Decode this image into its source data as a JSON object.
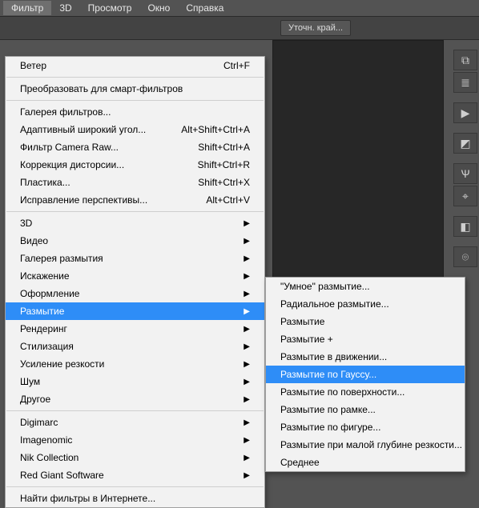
{
  "menubar": {
    "items": [
      {
        "label": "Фильтр",
        "active": true
      },
      {
        "label": "3D"
      },
      {
        "label": "Просмотр"
      },
      {
        "label": "Окно"
      },
      {
        "label": "Справка"
      }
    ]
  },
  "toolbar": {
    "refine_edge_label": "Уточн. край..."
  },
  "main_menu": {
    "groups": [
      [
        {
          "label": "Ветер",
          "accel": "Ctrl+F"
        }
      ],
      [
        {
          "label": "Преобразовать для смарт-фильтров"
        }
      ],
      [
        {
          "label": "Галерея фильтров..."
        },
        {
          "label": "Адаптивный широкий угол...",
          "accel": "Alt+Shift+Ctrl+A"
        },
        {
          "label": "Фильтр Camera Raw...",
          "accel": "Shift+Ctrl+A"
        },
        {
          "label": "Коррекция дисторсии...",
          "accel": "Shift+Ctrl+R"
        },
        {
          "label": "Пластика...",
          "accel": "Shift+Ctrl+X"
        },
        {
          "label": "Исправление перспективы...",
          "accel": "Alt+Ctrl+V"
        }
      ],
      [
        {
          "label": "3D",
          "submenu": true
        },
        {
          "label": "Видео",
          "submenu": true
        },
        {
          "label": "Галерея размытия",
          "submenu": true
        },
        {
          "label": "Искажение",
          "submenu": true
        },
        {
          "label": "Оформление",
          "submenu": true
        },
        {
          "label": "Размытие",
          "submenu": true,
          "highlight": true
        },
        {
          "label": "Рендеринг",
          "submenu": true
        },
        {
          "label": "Стилизация",
          "submenu": true
        },
        {
          "label": "Усиление резкости",
          "submenu": true
        },
        {
          "label": "Шум",
          "submenu": true
        },
        {
          "label": "Другое",
          "submenu": true
        }
      ],
      [
        {
          "label": "Digimarc",
          "submenu": true
        },
        {
          "label": "Imagenomic",
          "submenu": true
        },
        {
          "label": "Nik Collection",
          "submenu": true
        },
        {
          "label": "Red Giant Software",
          "submenu": true
        }
      ],
      [
        {
          "label": "Найти фильтры в Интернете..."
        }
      ]
    ]
  },
  "sub_menu": {
    "items": [
      {
        "label": "\"Умное\" размытие..."
      },
      {
        "label": "Радиальное размытие..."
      },
      {
        "label": "Размытие"
      },
      {
        "label": "Размытие +"
      },
      {
        "label": "Размытие в движении..."
      },
      {
        "label": "Размытие по Гауссу...",
        "highlight": true
      },
      {
        "label": "Размытие по поверхности..."
      },
      {
        "label": "Размытие по рамке..."
      },
      {
        "label": "Размытие по фигуре..."
      },
      {
        "label": "Размытие при малой глубине резкости..."
      },
      {
        "label": "Среднее"
      }
    ]
  },
  "right_rail": {
    "icons": [
      "histogram-icon",
      "layers-panel-icon",
      "play-icon",
      "cube-icon",
      "brushes-icon",
      "clone-source-icon",
      "swatches-icon",
      "mask-icon"
    ]
  }
}
